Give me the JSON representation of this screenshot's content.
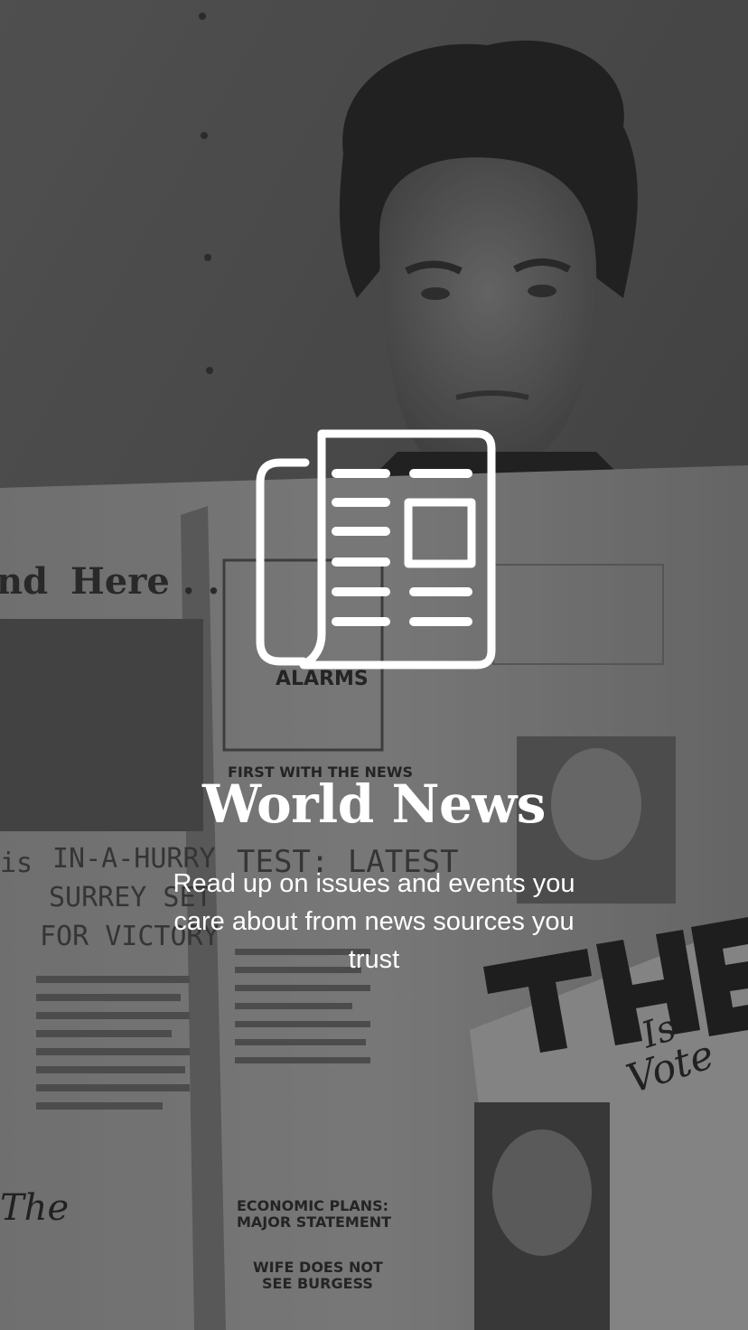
{
  "onboarding": {
    "title": "World News",
    "tagline": "Read up on issues and events you care about from news sources you trust",
    "icon": "newspaper-icon",
    "text_color": "#ffffff"
  },
  "background": {
    "photo_subject": "man reading a newspaper",
    "icon": "newspaper-reader-photo",
    "tint": "#000000"
  }
}
